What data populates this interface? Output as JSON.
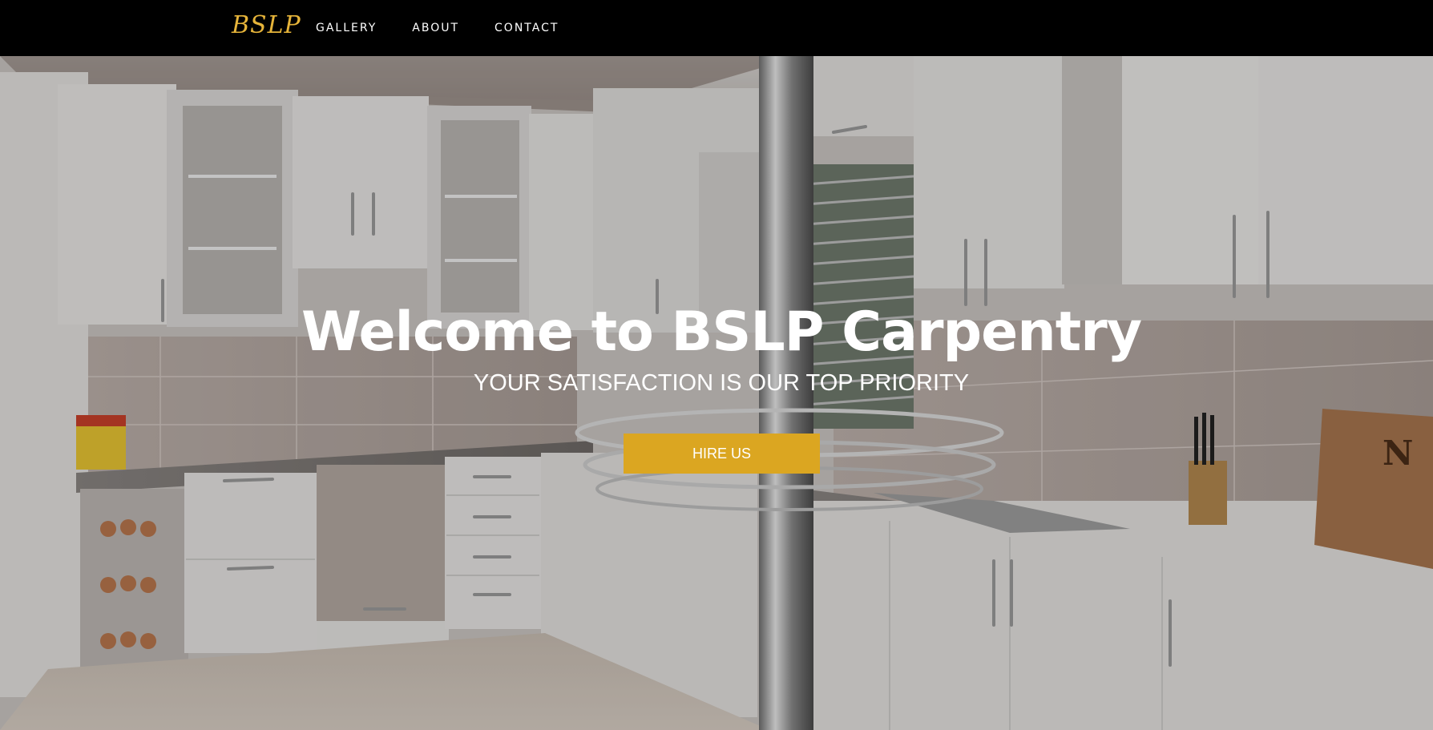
{
  "nav": {
    "logo": "BSLP",
    "links": [
      "GALLERY",
      "ABOUT",
      "CONTACT"
    ]
  },
  "hero": {
    "title": "Welcome to BSLP Carpentry",
    "subtitle": "YOUR SATISFACTION IS OUR TOP PRIORITY",
    "cta_label": "HIRE US",
    "background_image": "kitchen-photo",
    "cutting_board_text": "N"
  },
  "colors": {
    "nav_bg": "#000000",
    "logo": "#e6b43a",
    "cta": "#dba621",
    "text": "#ffffff"
  }
}
